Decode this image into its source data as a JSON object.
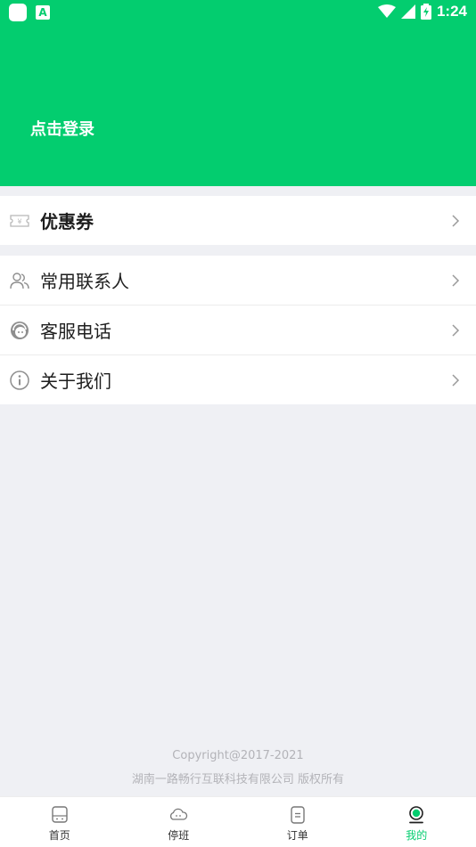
{
  "status_bar": {
    "time": "1:24",
    "notification_letter": "A"
  },
  "header": {
    "login_label": "点击登录"
  },
  "menu": {
    "coupon": "优惠券",
    "items": [
      {
        "label": "常用联系人"
      },
      {
        "label": "客服电话"
      },
      {
        "label": "关于我们"
      }
    ]
  },
  "footer": {
    "copyright": "Copyright@2017-2021",
    "company": "湖南一路畅行互联科技有限公司 版权所有"
  },
  "tabs": [
    {
      "label": "首页",
      "icon": "home-bus-icon"
    },
    {
      "label": "停班",
      "icon": "cloud-icon"
    },
    {
      "label": "订单",
      "icon": "order-icon"
    },
    {
      "label": "我的",
      "icon": "profile-icon",
      "active": true
    }
  ],
  "colors": {
    "brand": "#03cd6f",
    "background": "#eff0f4"
  }
}
